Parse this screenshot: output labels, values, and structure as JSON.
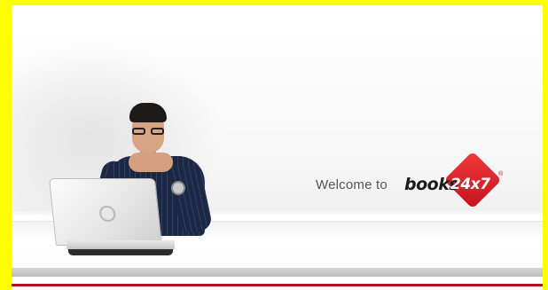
{
  "banner": {
    "welcome_text": "Welcome to",
    "brand_word": "books",
    "brand_number": "24x7",
    "brand_mark": "®"
  },
  "colors": {
    "page_border": "#ffff00",
    "brand_red": "#c4121e",
    "rule_red": "#b4101f",
    "welcome_gray": "#555555"
  },
  "icons": {
    "laptop_logo": "laptop-logo-icon"
  }
}
